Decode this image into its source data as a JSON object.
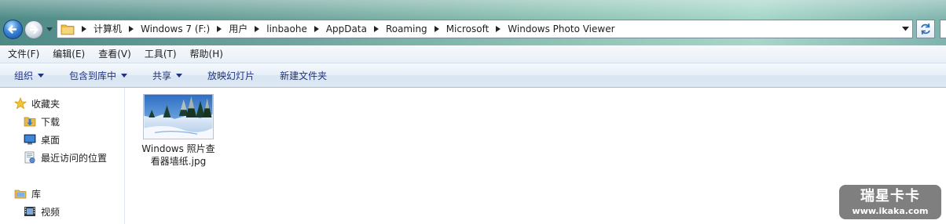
{
  "address_bar": {
    "crumbs": [
      "计算机",
      "Windows 7 (F:)",
      "用户",
      "linbaohe",
      "AppData",
      "Roaming",
      "Microsoft",
      "Windows Photo Viewer"
    ]
  },
  "menu": {
    "items": [
      "文件(F)",
      "编辑(E)",
      "查看(V)",
      "工具(T)",
      "帮助(H)"
    ]
  },
  "commands": {
    "organize": "组织",
    "include_in_library": "包含到库中",
    "share": "共享",
    "slideshow": "放映幻灯片",
    "new_folder": "新建文件夹"
  },
  "nav_pane": {
    "favorites": "收藏夹",
    "downloads": "下载",
    "desktop": "桌面",
    "recent": "最近访问的位置",
    "libraries": "库",
    "videos": "视频"
  },
  "files": [
    {
      "name": "Windows 照片查看器墙纸.jpg"
    }
  ],
  "watermark": {
    "title": "瑞星卡卡",
    "url": "www.ikaka.com"
  }
}
